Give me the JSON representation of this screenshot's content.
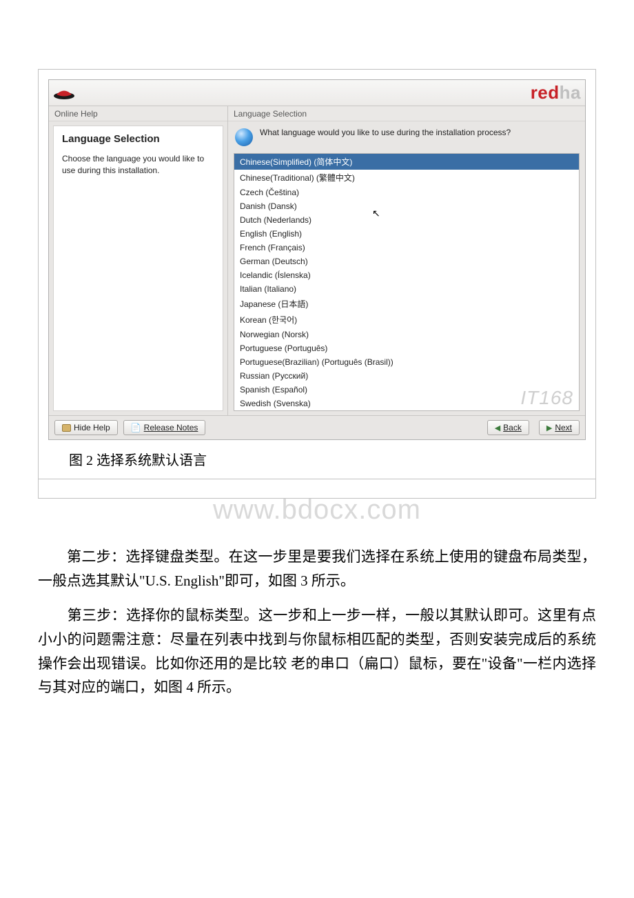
{
  "brand": {
    "red": "red",
    "ha": "ha"
  },
  "leftCol": {
    "header": "Online Help",
    "title": "Language Selection",
    "text": "Choose the language you would like to use during this installation."
  },
  "rightCol": {
    "header": "Language Selection",
    "prompt": "What language would you like to use during the installation process?",
    "languages": [
      "Chinese(Simplified) (简体中文)",
      "Chinese(Traditional) (繁體中文)",
      "Czech (Čeština)",
      "Danish (Dansk)",
      "Dutch (Nederlands)",
      "English (English)",
      "French (Français)",
      "German (Deutsch)",
      "Icelandic (Íslenska)",
      "Italian (Italiano)",
      "Japanese (日本語)",
      "Korean (한국어)",
      "Norwegian (Norsk)",
      "Portuguese (Português)",
      "Portuguese(Brazilian) (Português (Brasil))",
      "Russian (Русский)",
      "Spanish (Español)",
      "Swedish (Svenska)"
    ],
    "watermark": "IT168"
  },
  "footer": {
    "hideHelp": "Hide Help",
    "releaseNotes": "Release Notes",
    "back": "Back",
    "next": "Next"
  },
  "caption": "图 2 选择系统默认语言",
  "watermarkDomain": "www.bdocx.com",
  "para1_a": "第二步：选择键盘类型。在这一步里是要我们选择在系统上使用的键盘布局类型，一般点选其默认",
  "para1_b": "\"U.S. English\"即可，如图",
  "para1_c": "3",
  "para1_d": "所示。",
  "para2_a": "　　第三步：选择你的鼠标类型。这一步和上一步一样，一般以其默认即可。这里有点小小的问题需注意：尽量在列表中找到与你鼠标相匹配的类型，否则安装完成后的系统操作会出现错误。比如你还用的是比较 老的串口（扁口）鼠标，要在\"设备\"一栏内选择与其对应的端口，如图",
  "para2_b": "4",
  "para2_c": "所示。"
}
